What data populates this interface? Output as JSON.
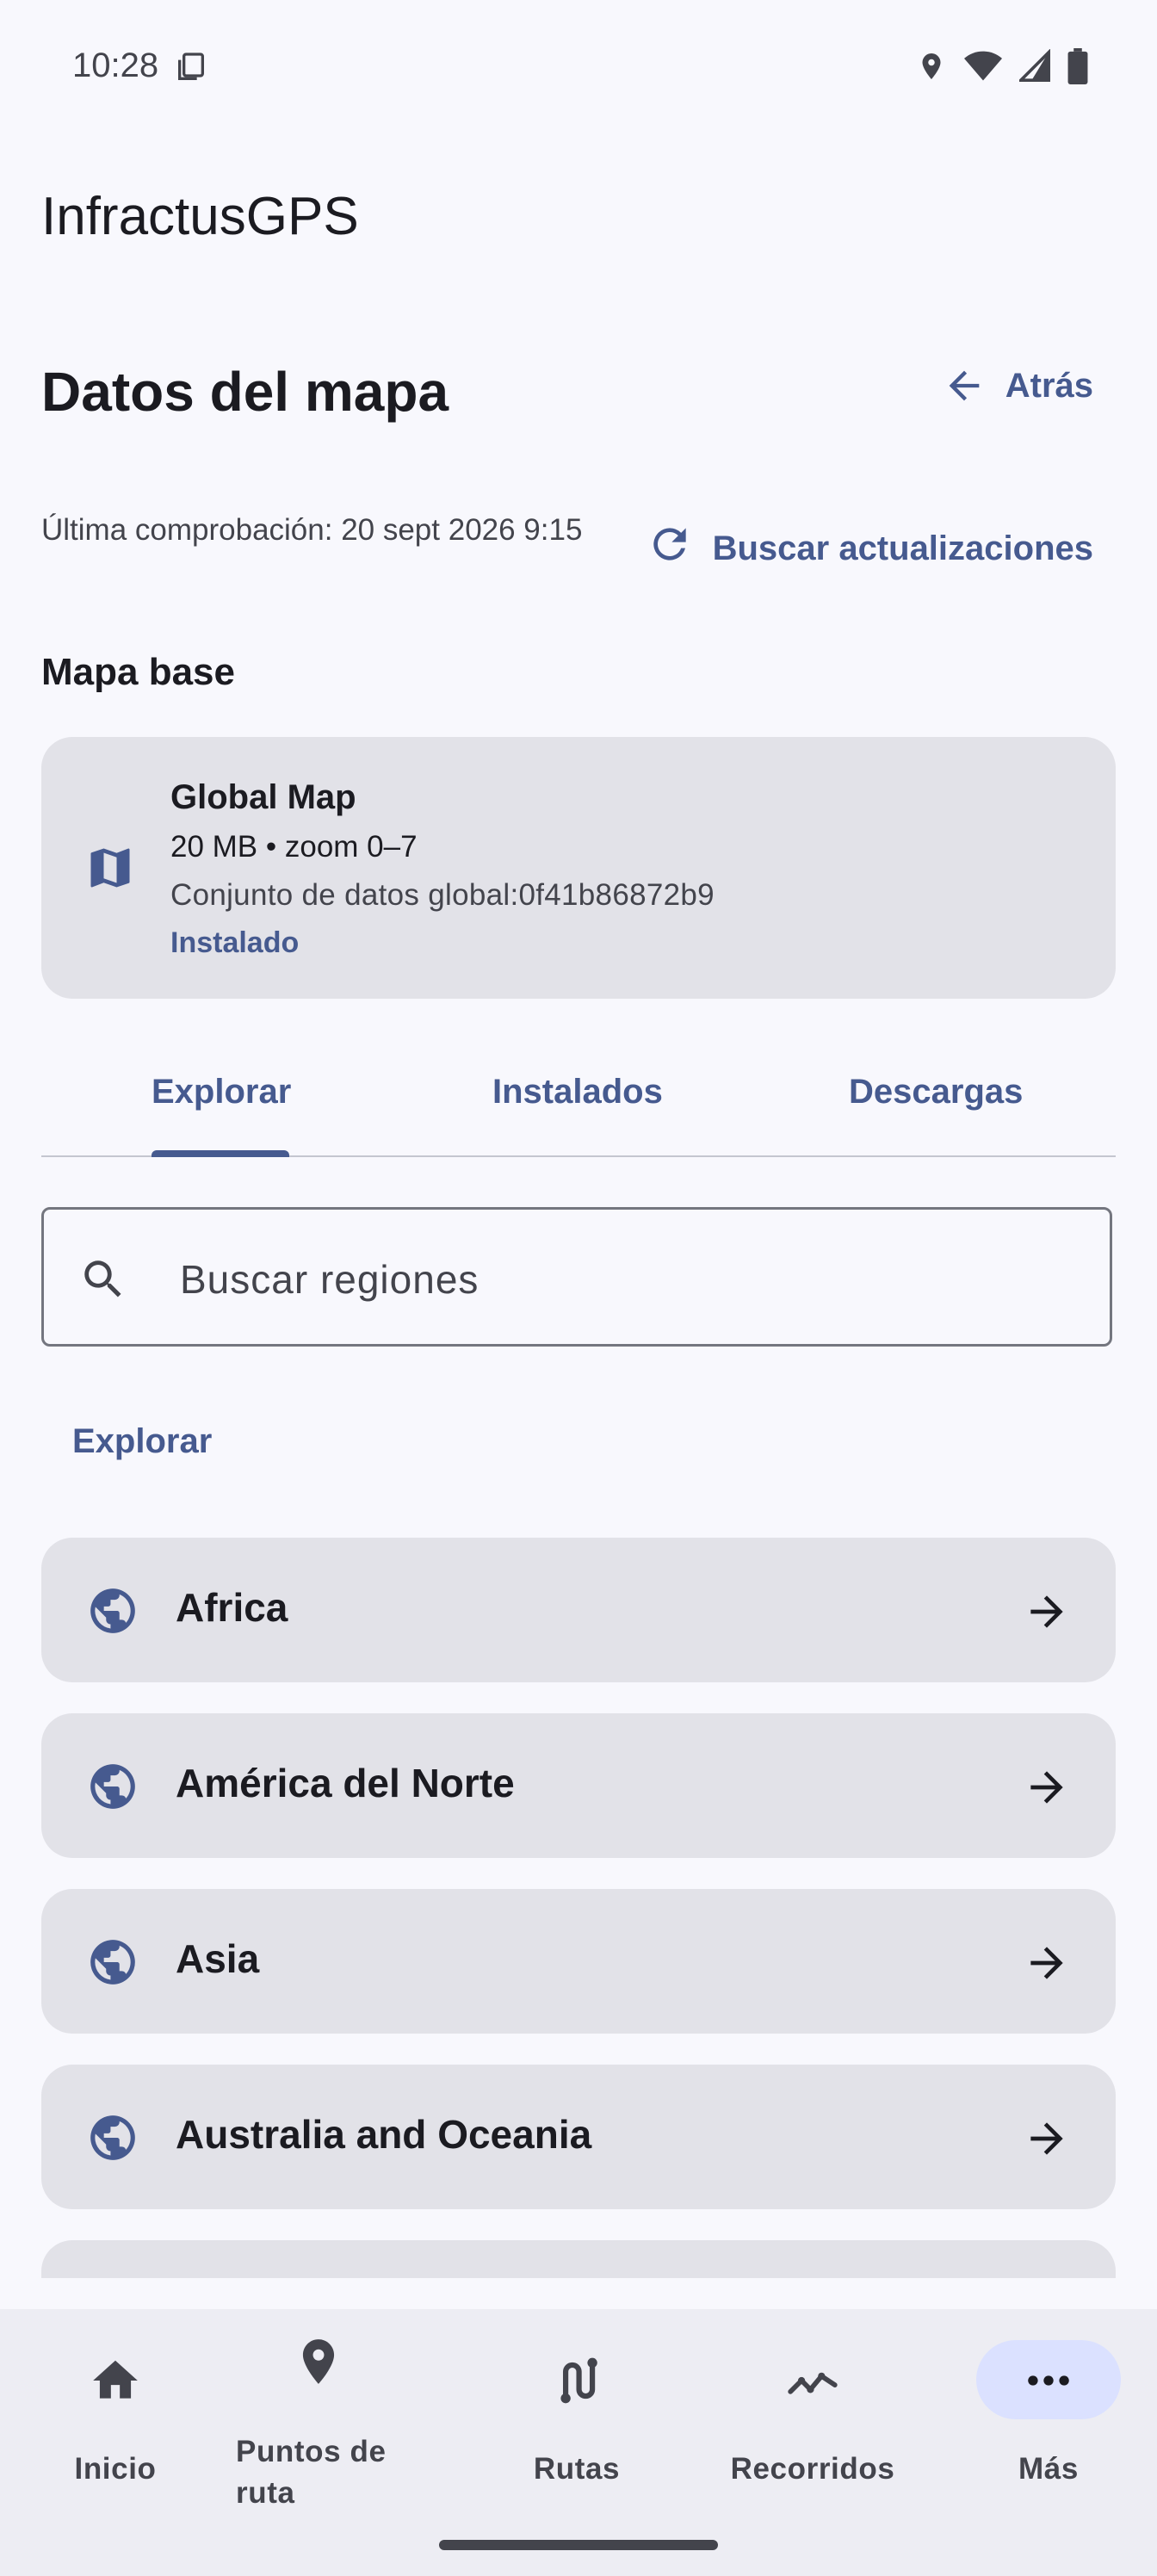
{
  "status_bar": {
    "time": "10:28"
  },
  "app": {
    "title": "InfractusGPS"
  },
  "header": {
    "title": "Datos del mapa",
    "back_label": "Atrás"
  },
  "update": {
    "last_check": "Última comprobación: 20 sept 2026 9:15",
    "button_label": "Buscar actualizaciones"
  },
  "base_map": {
    "section_title": "Mapa base",
    "name": "Global Map",
    "meta": "20 MB • zoom 0–7",
    "dataset": "Conjunto de datos global:0f41b86872b9",
    "status": "Instalado"
  },
  "tabs": [
    {
      "label": "Explorar",
      "selected": true
    },
    {
      "label": "Instalados",
      "selected": false
    },
    {
      "label": "Descargas",
      "selected": false
    }
  ],
  "search": {
    "placeholder": "Buscar regiones"
  },
  "explore": {
    "label": "Explorar",
    "regions": [
      {
        "name": "Africa"
      },
      {
        "name": "América del Norte"
      },
      {
        "name": "Asia"
      },
      {
        "name": "Australia and Oceania"
      },
      {
        "name": ""
      }
    ]
  },
  "bottom_nav": {
    "items": [
      {
        "label": "Inicio",
        "icon": "home-icon"
      },
      {
        "label": "Puntos de ruta",
        "icon": "location-pin-icon"
      },
      {
        "label": "Rutas",
        "icon": "route-icon"
      },
      {
        "label": "Recorridos",
        "icon": "tracks-icon"
      },
      {
        "label": "Más",
        "icon": "more-icon",
        "selected": true
      }
    ]
  },
  "colors": {
    "primary": "#465a8f",
    "surface": "#f8f8fd",
    "card": "#e2e2e8",
    "nav_background": "#ededf3",
    "nav_selected_pill": "#dbe1ff"
  }
}
